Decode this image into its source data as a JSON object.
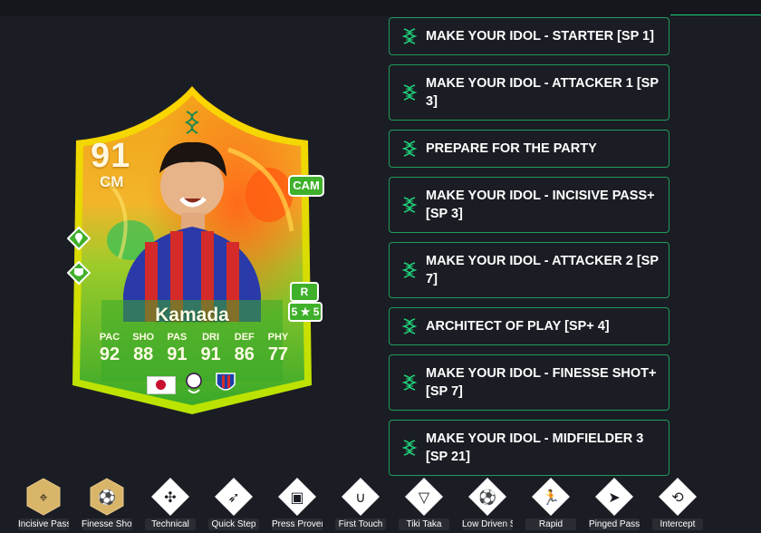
{
  "player": {
    "rating": "91",
    "position": "CM",
    "alt_position": "CAM",
    "preferred_foot": "R",
    "skill_weak": "5 ★ 5",
    "name": "Kamada",
    "stats": [
      {
        "label": "PAC",
        "value": "92"
      },
      {
        "label": "SHO",
        "value": "88"
      },
      {
        "label": "PAS",
        "value": "91"
      },
      {
        "label": "DRI",
        "value": "91"
      },
      {
        "label": "DEF",
        "value": "86"
      },
      {
        "label": "PHY",
        "value": "77"
      }
    ]
  },
  "objectives": [
    "MAKE YOUR IDOL - STARTER [SP 1]",
    "MAKE YOUR IDOL - ATTACKER 1 [SP 3]",
    "PREPARE FOR THE PARTY",
    "MAKE YOUR IDOL - INCISIVE PASS+ [SP 3]",
    "MAKE YOUR IDOL - ATTACKER 2 [SP 7]",
    "ARCHITECT OF PLAY [SP+ 4]",
    "MAKE YOUR IDOL - FINESSE SHOT+ [SP 7]",
    "MAKE YOUR IDOL - MIDFIELDER 3 [SP 21]"
  ],
  "playstyles": [
    {
      "label": "Incisive Pass",
      "icon": "incisive-pass-icon",
      "plus": true
    },
    {
      "label": "Finesse Shot",
      "icon": "finesse-shot-icon",
      "plus": true
    },
    {
      "label": "Technical",
      "icon": "technical-icon",
      "plus": false
    },
    {
      "label": "Quick Step",
      "icon": "quick-step-icon",
      "plus": false
    },
    {
      "label": "Press Proven",
      "icon": "press-proven-icon",
      "plus": false
    },
    {
      "label": "First Touch",
      "icon": "first-touch-icon",
      "plus": false
    },
    {
      "label": "Tiki Taka",
      "icon": "tiki-taka-icon",
      "plus": false
    },
    {
      "label": "Low Driven Shot",
      "icon": "low-driven-shot-icon",
      "plus": false
    },
    {
      "label": "Rapid",
      "icon": "rapid-icon",
      "plus": false
    },
    {
      "label": "Pinged Pass",
      "icon": "pinged-pass-icon",
      "plus": false
    },
    {
      "label": "Intercept",
      "icon": "intercept-icon",
      "plus": false
    }
  ],
  "colors": {
    "accent": "#1fd27a",
    "card_gold": "#f5c400",
    "card_green": "#3fb02a",
    "playstyle_plus": "#d9b56a"
  }
}
